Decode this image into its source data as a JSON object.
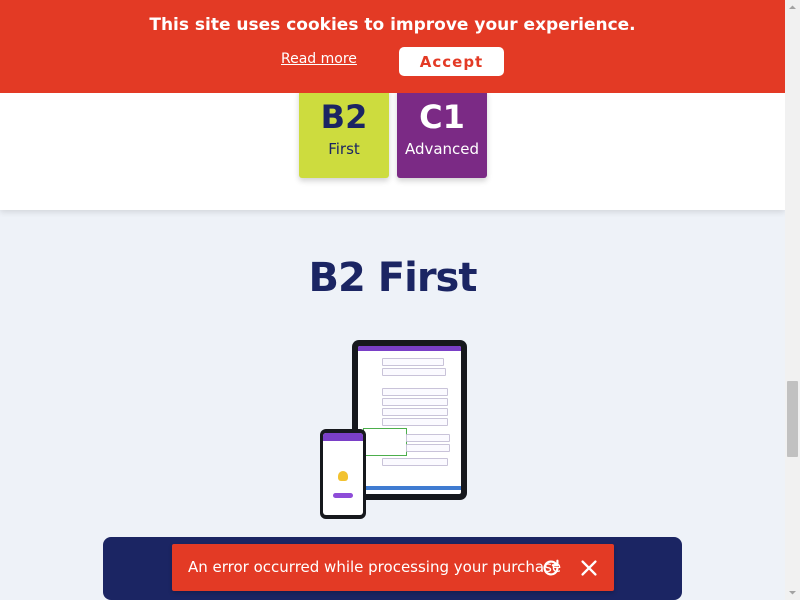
{
  "cookie_banner": {
    "message": "This site uses cookies to improve your experience.",
    "read_more": "Read more",
    "accept": "Accept"
  },
  "levels": [
    {
      "code": "B2",
      "name": "First",
      "color": "#cddc3e"
    },
    {
      "code": "C1",
      "name": "Advanced",
      "color": "#7b2a85"
    }
  ],
  "section": {
    "title": "B2 First"
  },
  "error_toast": {
    "message": "An error occurred while processing your purchase",
    "retry_icon": "refresh-icon",
    "close_icon": "close-icon"
  },
  "colors": {
    "brand_red": "#e33a25",
    "navy": "#1b2563",
    "page_bg": "#eef2f8"
  }
}
